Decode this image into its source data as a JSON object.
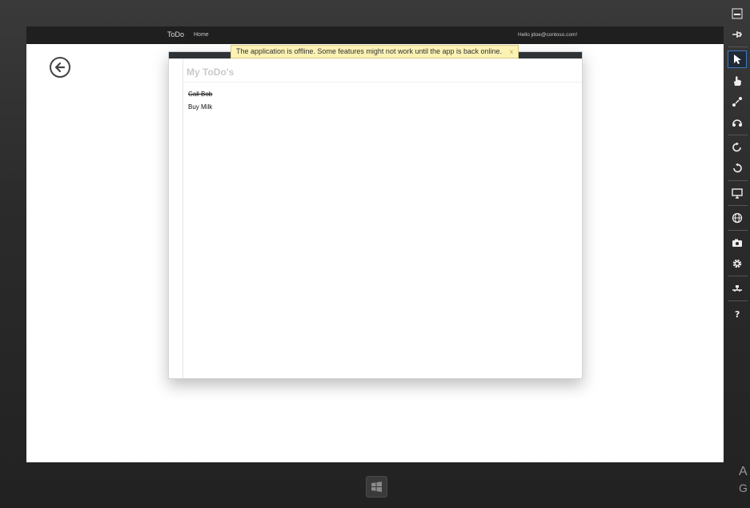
{
  "app": {
    "brand": "ToDo",
    "nav_home": "Home",
    "hello": "Hello jdoe@contoso.com!"
  },
  "banner": {
    "message": "The application is offline. Some features might not work until the app is back online.",
    "close": "x"
  },
  "main": {
    "title": "My ToDo's",
    "items": [
      {
        "label": "Call Bob",
        "done": true
      },
      {
        "label": "Buy Milk",
        "done": false
      }
    ]
  },
  "toolbar": {
    "icons": [
      "minimize-icon",
      "pin-icon",
      "pointer-icon",
      "hand-icon",
      "pinch-zoom-icon",
      "rotate-touch-icon",
      "rotate-clockwise-icon",
      "rotate-counterclockwise-icon",
      "resolution-icon",
      "globe-icon",
      "camera-icon",
      "settings-icon",
      "network-icon",
      "help-icon"
    ]
  },
  "corner": {
    "line1": "A",
    "line2": "G"
  },
  "colors": {
    "appbar": "#1f1f1f",
    "banner": "#fcf2b4",
    "frame_top": "#2e3338"
  }
}
